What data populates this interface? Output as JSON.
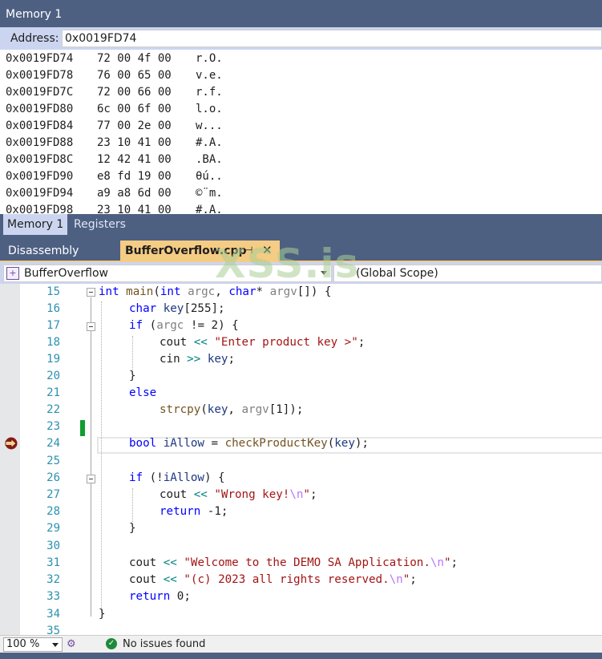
{
  "memory_window": {
    "title": "Memory 1",
    "address_label": "Address:",
    "address_value": "0x0019FD74",
    "rows": [
      {
        "addr": "0x0019FD74",
        "bytes": "72 00 4f 00",
        "ascii": "r.O."
      },
      {
        "addr": "0x0019FD78",
        "bytes": "76 00 65 00",
        "ascii": "v.e."
      },
      {
        "addr": "0x0019FD7C",
        "bytes": "72 00 66 00",
        "ascii": "r.f."
      },
      {
        "addr": "0x0019FD80",
        "bytes": "6c 00 6f 00",
        "ascii": "l.o."
      },
      {
        "addr": "0x0019FD84",
        "bytes": "77 00 2e 00",
        "ascii": "w..."
      },
      {
        "addr": "0x0019FD88",
        "bytes": "23 10 41 00",
        "ascii": "#.A."
      },
      {
        "addr": "0x0019FD8C",
        "bytes": "12 42 41 00",
        "ascii": ".BA."
      },
      {
        "addr": "0x0019FD90",
        "bytes": "e8 fd 19 00",
        "ascii": "θú.."
      },
      {
        "addr": "0x0019FD94",
        "bytes": "a9 a8 6d 00",
        "ascii": "©¨m."
      },
      {
        "addr": "0x0019FD98",
        "bytes": "23 10 41 00",
        "ascii": "#.A."
      }
    ],
    "tabs": [
      "Memory 1",
      "Registers"
    ]
  },
  "editor": {
    "tabs": {
      "disassembly": "Disassembly",
      "file": "BufferOverflow.cpp",
      "pin_icon": "pin-icon",
      "close_icon": "close-icon"
    },
    "nav": {
      "project": "BufferOverflow",
      "scope": "(Global Scope)"
    },
    "line_numbers": [
      "15",
      "16",
      "17",
      "18",
      "19",
      "20",
      "21",
      "22",
      "23",
      "24",
      "25",
      "26",
      "27",
      "28",
      "29",
      "30",
      "31",
      "32",
      "33",
      "34",
      "35"
    ],
    "code": {
      "l15": {
        "t1": "int",
        "t2": "main",
        "t3": "(",
        "t4": "int",
        "t5": "argc",
        "t6": ", ",
        "t7": "char",
        "t8": "* ",
        "t9": "argv",
        "t10": "[]) {"
      },
      "l16": {
        "t1": "char",
        "t2": "key",
        "t3": "[255];"
      },
      "l17": {
        "t1": "if",
        "t2": " (",
        "t3": "argc",
        "t4": " != 2) {"
      },
      "l18": {
        "t1": "cout",
        "t2": "<<",
        "t3": "\"Enter product key >\"",
        "t4": ";"
      },
      "l19": {
        "t1": "cin",
        "t2": ">>",
        "t3": "key",
        "t4": ";"
      },
      "l20": {
        "t1": "}"
      },
      "l21": {
        "t1": "else"
      },
      "l22": {
        "t1": "strcpy",
        "t2": "(",
        "t3": "key",
        "t4": ", ",
        "t5": "argv",
        "t6": "[1]);"
      },
      "l24": {
        "t1": "bool",
        "t2": "iAllow",
        "t3": " = ",
        "t4": "checkProductKey",
        "t5": "(",
        "t6": "key",
        "t7": ");"
      },
      "l26": {
        "t1": "if",
        "t2": " (!",
        "t3": "iAllow",
        "t4": ") {"
      },
      "l27": {
        "t1": "cout",
        "t2": "<<",
        "t3": "\"Wrong key!",
        "t4": "\\n",
        "t5": "\"",
        "t6": ";"
      },
      "l28": {
        "t1": "return",
        "t2": " -1;"
      },
      "l29": {
        "t1": "}"
      },
      "l31": {
        "t1": "cout",
        "t2": "<<",
        "t3": "\"Welcome to the DEMO SA Application.",
        "t4": "\\n",
        "t5": "\"",
        "t6": ";"
      },
      "l32": {
        "t1": "cout",
        "t2": "<<",
        "t3": "\"(c) 2023 all rights reserved.",
        "t4": "\\n",
        "t5": "\"",
        "t6": ";"
      },
      "l33": {
        "t1": "return",
        "t2": " 0;"
      },
      "l34": {
        "t1": "}"
      }
    },
    "current_line": "24"
  },
  "status_bar": {
    "zoom": "100 %",
    "issues": "No issues found"
  },
  "watermark": "XSS.is",
  "colors": {
    "keyword": "#0000ff",
    "function": "#74531f",
    "param": "#808080",
    "local": "#1f377f",
    "string": "#a31515",
    "escape": "#b776fb",
    "operator": "#008080",
    "linenum": "#2b91af",
    "tab_active": "#f5cc84",
    "chrome": "#4d6082"
  }
}
